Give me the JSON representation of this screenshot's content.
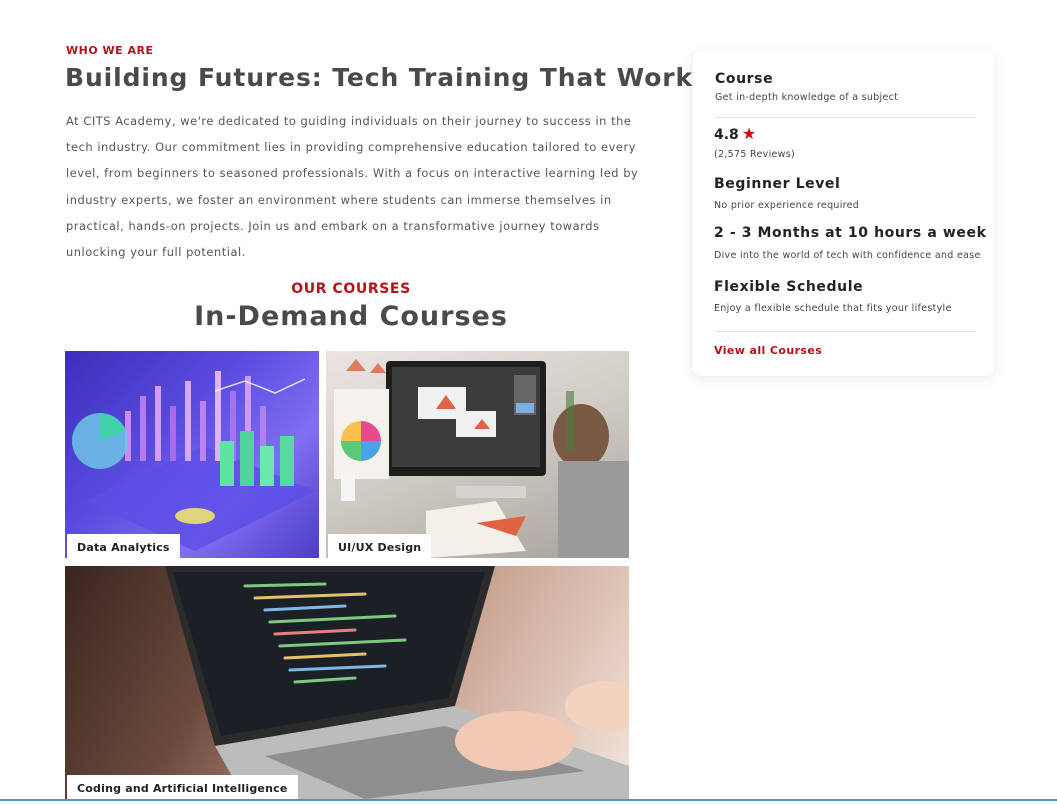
{
  "about": {
    "eyebrow": "WHO WE ARE",
    "headline": "Building Futures: Tech Training That Works",
    "paragraph": "At CITS Academy, we're dedicated to guiding individuals on their journey to success in the tech industry. Our commitment lies in providing comprehensive education tailored to every level, from beginners to seasoned professionals. With a focus on interactive learning led by industry experts, we foster an environment where students can immerse themselves in practical, hands-on projects. Join us and embark on a transformative journey towards unlocking your full potential."
  },
  "courses": {
    "eyebrow": "OUR COURSES",
    "title": "In-Demand Courses",
    "items": [
      {
        "label": "Data Analytics"
      },
      {
        "label": "UI/UX Design"
      },
      {
        "label": "Coding and Artificial Intelligence"
      }
    ]
  },
  "card": {
    "title": "Course",
    "subtitle": "Get in-depth knowledge of a subject",
    "rating": "4.8",
    "star": "★",
    "reviews": "(2,575 Reviews)",
    "level_title": "Beginner Level",
    "level_desc": "No prior experience required",
    "duration_title": "2 - 3 Months at 10 hours a week",
    "duration_desc": "Dive into the world of tech with confidence and ease",
    "schedule_title": "Flexible Schedule",
    "schedule_desc": "Enjoy a flexible schedule that fits your lifestyle",
    "link": "View all Courses"
  },
  "colors": {
    "accent": "#b5121b",
    "star": "#d0021b",
    "heading": "#4a4a4a"
  }
}
